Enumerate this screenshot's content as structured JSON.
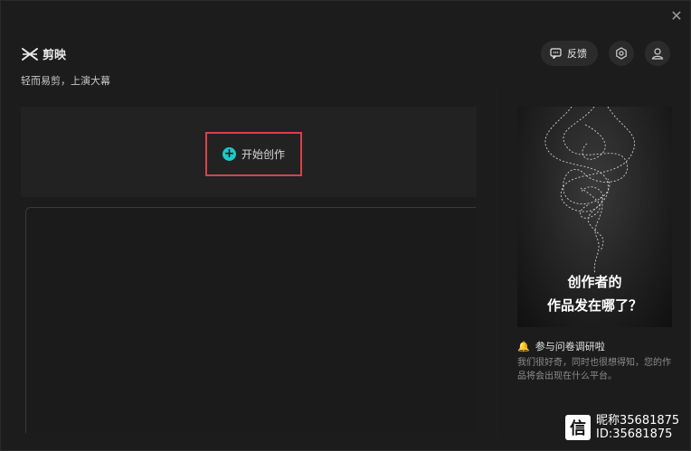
{
  "window": {
    "close_symbol": "✕"
  },
  "brand": {
    "name": "剪映",
    "slogan": "轻而易剪，上演大幕"
  },
  "top_actions": {
    "feedback_label": "反馈"
  },
  "create": {
    "label": "开始创作",
    "plus_symbol": "+"
  },
  "promo": {
    "line1": "创作者的",
    "line2": "作品发在哪了？"
  },
  "survey": {
    "title": "参与问卷调研啦",
    "description": "我们很好奇，同时也很想得知，您的作品将会出现在什么平台。"
  },
  "watermark": {
    "logo_glyph": "信",
    "line1": "昵称35681875",
    "line2": "ID:35681875"
  },
  "colors": {
    "accent_cyan": "#1fc7c8",
    "highlight_red": "#d9414b",
    "bell_yellow": "#f2b01e"
  }
}
